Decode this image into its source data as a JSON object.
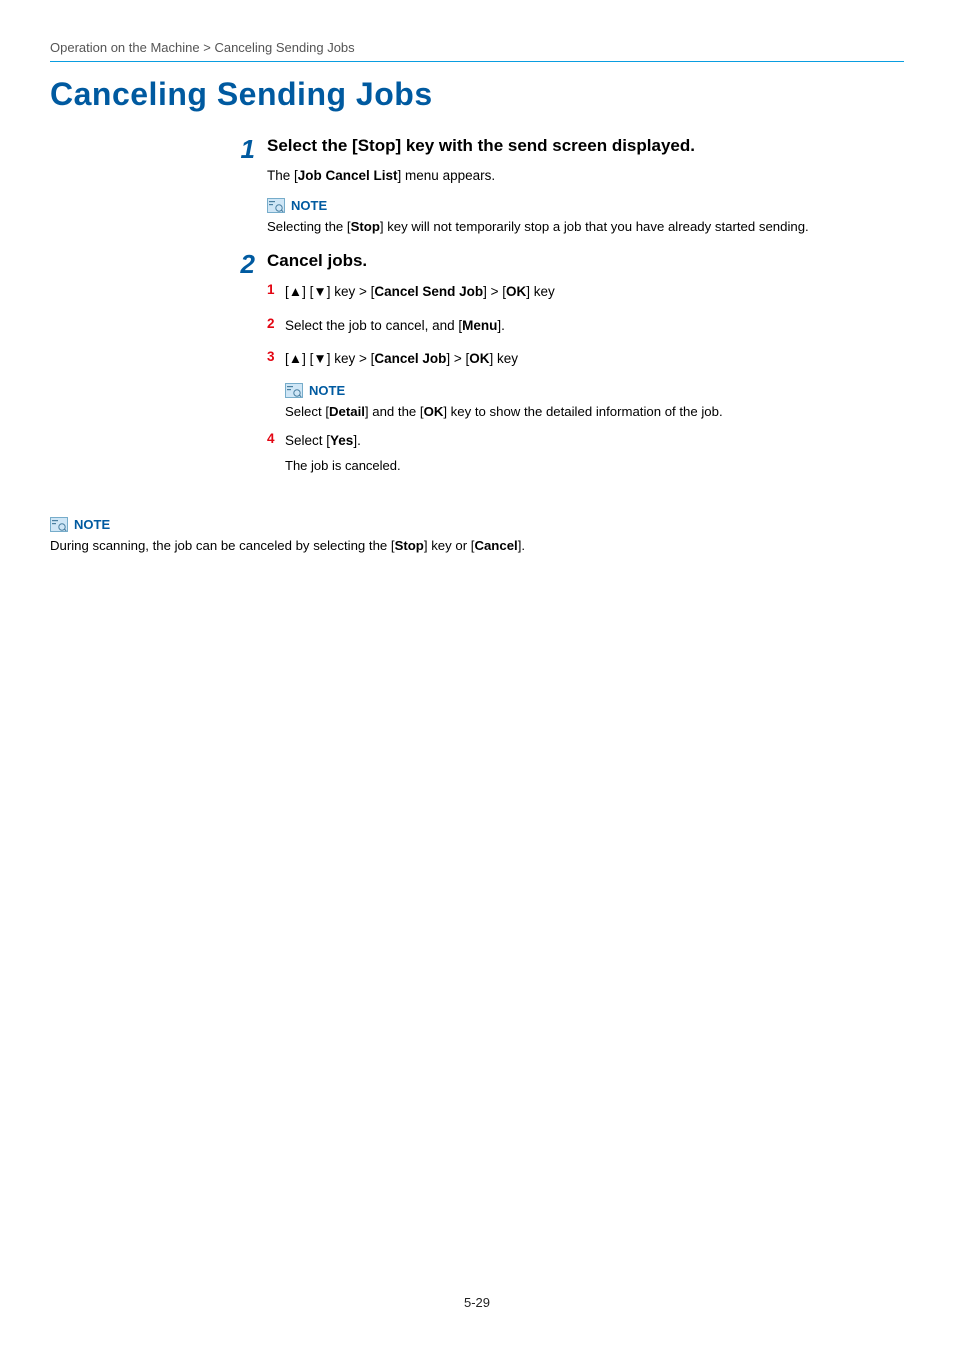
{
  "breadcrumb": {
    "section": "Operation on the Machine",
    "sep": ">",
    "topic": "Canceling Sending Jobs"
  },
  "page_title": "Canceling Sending Jobs",
  "step1": {
    "num": "1",
    "title": "Select the [Stop] key with the send screen displayed.",
    "lead_pre": "The [",
    "lead_bold": "Job Cancel List",
    "lead_post": "] menu appears.",
    "note_label": "NOTE",
    "note_pre": "Selecting the [",
    "note_bold": "Stop",
    "note_post": "] key will not temporarily stop a job that you have already started sending."
  },
  "step2": {
    "num": "2",
    "title": "Cancel jobs.",
    "items": {
      "n1": "1",
      "t1_pre": "[▲] [▼] key > [",
      "t1_b1": "Cancel Send Job",
      "t1_mid": "] > [",
      "t1_b2": "OK",
      "t1_post": "] key",
      "n2": "2",
      "t2_pre": "Select the job to cancel, and [",
      "t2_b": "Menu",
      "t2_post": "].",
      "n3": "3",
      "t3_pre": "[▲] [▼] key > [",
      "t3_b1": "Cancel Job",
      "t3_mid": "] > [",
      "t3_b2": "OK",
      "t3_post": "] key",
      "note_label": "NOTE",
      "note_pre": "Select [",
      "note_b1": "Detail",
      "note_mid": "] and the [",
      "note_b2": "OK",
      "note_post": "] key to show the detailed information of the job.",
      "n4": "4",
      "t4_pre": "Select [",
      "t4_b": "Yes",
      "t4_post": "].",
      "t4_sub": "The job is canceled."
    }
  },
  "bottom_note": {
    "label": "NOTE",
    "pre": "During scanning, the job can be canceled by selecting the [",
    "b1": "Stop",
    "mid": "] key or [",
    "b2": "Cancel",
    "post": "]."
  },
  "footer": "5-29"
}
